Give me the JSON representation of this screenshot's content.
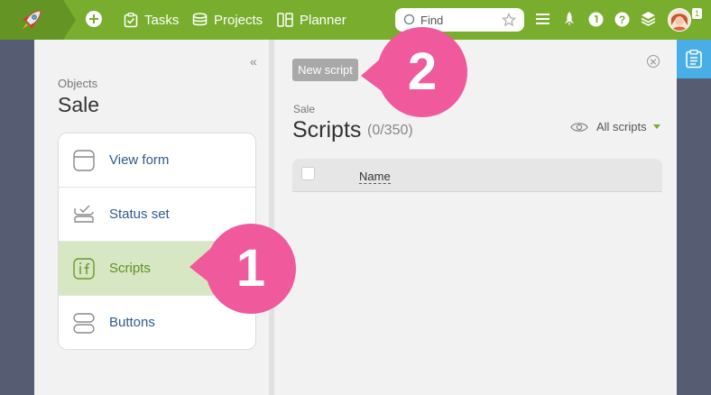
{
  "topbar": {
    "nav": [
      {
        "label": "Tasks",
        "icon": "tasks-icon"
      },
      {
        "label": "Projects",
        "icon": "projects-icon"
      },
      {
        "label": "Planner",
        "icon": "planner-icon"
      }
    ],
    "search_placeholder": "Find",
    "avatar_badge": "1",
    "colors": {
      "bar": "#78ad2d",
      "logo_bg": "#639424"
    }
  },
  "objects": {
    "caption": "Objects",
    "title": "Sale",
    "collapse_glyph": "«",
    "menu": [
      {
        "label": "View form",
        "icon": "view-form-icon"
      },
      {
        "label": "Status set",
        "icon": "status-set-icon"
      },
      {
        "label": "Scripts",
        "icon": "scripts-icon",
        "active": true
      },
      {
        "label": "Buttons",
        "icon": "buttons-icon"
      }
    ]
  },
  "scripts": {
    "new_button": "New script",
    "breadcrumb": "Sale",
    "title": "Scripts",
    "count": "(0/350)",
    "filter_label": "All scripts",
    "table": {
      "columns": [
        "Name"
      ]
    }
  },
  "callouts": [
    {
      "number": "1",
      "color": "#f0599b"
    },
    {
      "number": "2",
      "color": "#f0599b"
    }
  ]
}
